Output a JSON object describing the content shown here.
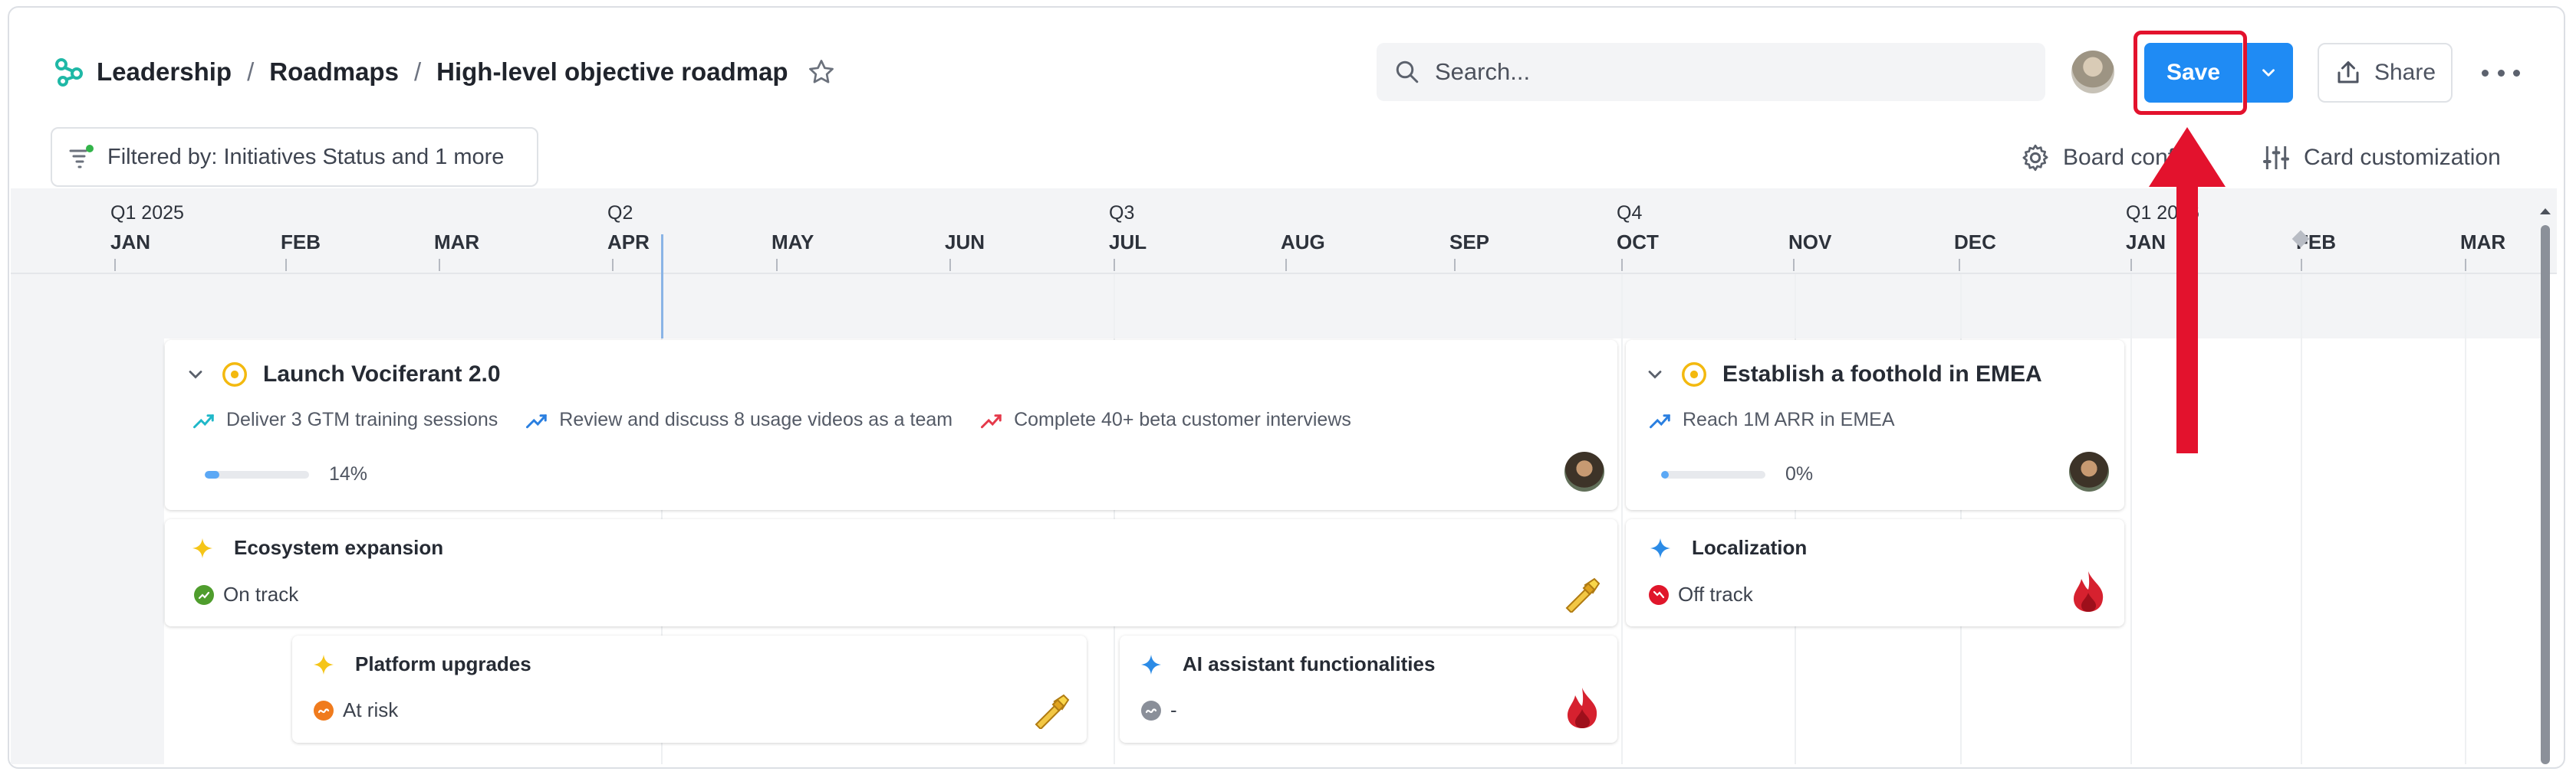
{
  "breadcrumb": {
    "root": "Leadership",
    "section": "Roadmaps",
    "page": "High-level objective roadmap",
    "separator": "/"
  },
  "search": {
    "placeholder": "Search..."
  },
  "toolbar": {
    "save_label": "Save",
    "share_label": "Share",
    "filter_label": "Filtered by: Initiatives Status and 1 more",
    "board_config_label": "Board config",
    "card_customization_label": "Card customization"
  },
  "timeline": {
    "quarters": [
      "Q1 2025",
      "Q2",
      "Q3",
      "Q4",
      "Q1 2026"
    ],
    "months": [
      "JAN",
      "FEB",
      "MAR",
      "APR",
      "MAY",
      "JUN",
      "JUL",
      "AUG",
      "SEP",
      "OCT",
      "NOV",
      "DEC",
      "JAN",
      "FEB",
      "MAR"
    ]
  },
  "objectives": [
    {
      "title": "Launch Vociferant 2.0",
      "key_results": [
        {
          "label": "Deliver 3 GTM training sessions",
          "color": "#1fb8c9"
        },
        {
          "label": "Review and discuss 8 usage videos as a team",
          "color": "#2a7fe0"
        },
        {
          "label": "Complete 40+ beta customer interviews",
          "color": "#e5394a"
        }
      ],
      "progress_text": "14%",
      "progress": 0.14
    },
    {
      "title": "Establish a foothold in EMEA",
      "key_results": [
        {
          "label": "Reach 1M ARR in EMEA",
          "color": "#2a7fe0"
        }
      ],
      "progress_text": "0%",
      "progress": 0
    }
  ],
  "initiatives": [
    {
      "title": "Ecosystem expansion",
      "status": "On track",
      "status_color": "#4f9d2d",
      "icon_color": "#f5c518",
      "owner_icon": "flashlight-icon"
    },
    {
      "title": "Localization",
      "status": "Off track",
      "status_color": "#e0162b",
      "icon_color": "#2b8be6",
      "owner_icon": "flame-icon"
    },
    {
      "title": "Platform upgrades",
      "status": "At risk",
      "status_color": "#f07b1d",
      "icon_color": "#f5c518",
      "owner_icon": "flashlight-icon"
    },
    {
      "title": "AI assistant functionalities",
      "status": "-",
      "status_color": "#8a8f99",
      "icon_color": "#2b8be6",
      "owner_icon": "flame-icon"
    }
  ],
  "colors": {
    "accent": "#1f8bf4",
    "annotation": "#e3122d"
  }
}
